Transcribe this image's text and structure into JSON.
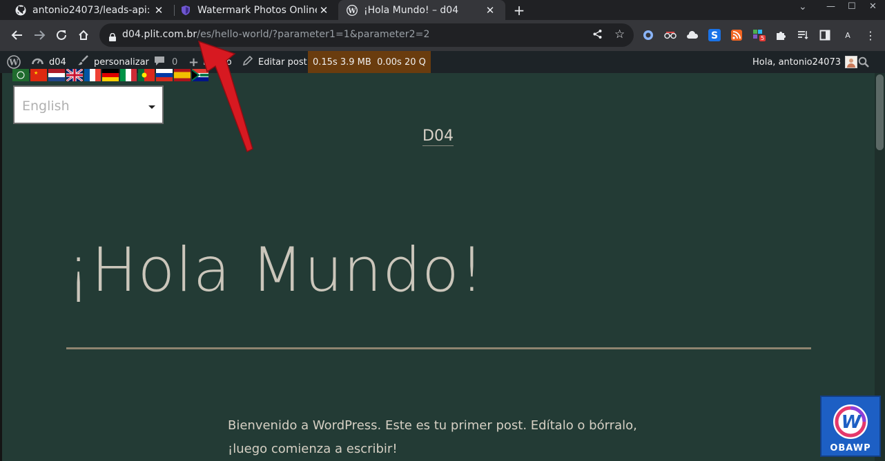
{
  "browser": {
    "tabs": [
      {
        "title": "antonio24073/leads-api:",
        "icon": "github-icon",
        "active": false
      },
      {
        "title": "Watermark Photos Online",
        "icon": "shield-icon",
        "active": false
      },
      {
        "title": "¡Hola Mundo! – d04",
        "icon": "wordpress-icon",
        "active": true
      }
    ],
    "new_tab_icon": "+",
    "url_host": "d04.plit.com.br",
    "url_path": "/es/hello-world/?parameter1=1&parameter2=2",
    "extension_badge": "5",
    "profile_letter": "A"
  },
  "adminbar": {
    "site_name": "d04",
    "customize": "personalizar",
    "comments_count": "0",
    "new_label": "Nuevo",
    "edit_post": "Editar post",
    "query_monitor_time": "0.15s",
    "query_monitor_mem": "3.9 MB",
    "query_monitor_db": "0.00s",
    "query_monitor_queries": "20 Q",
    "greeting": "Hola, antonio24073"
  },
  "language_switcher": {
    "selected": "English",
    "flags": [
      "ar",
      "zh",
      "nl",
      "en",
      "fr",
      "de",
      "it",
      "pt",
      "ru",
      "es",
      "za"
    ]
  },
  "page": {
    "site_title": "D04",
    "post_title": "¡Hola Mundo!",
    "post_body_line1": "Bienvenido a WordPress. Este es tu primer post. Edítalo o bórralo,",
    "post_body_line2": "¡luego comienza a escribir!"
  },
  "badge": {
    "label": "OBAWP"
  },
  "colors": {
    "page_bg": "#233b35",
    "adminbar_bg": "#1d2327",
    "query_monitor_bg": "#6a3c0e",
    "arrow": "#d71921"
  }
}
